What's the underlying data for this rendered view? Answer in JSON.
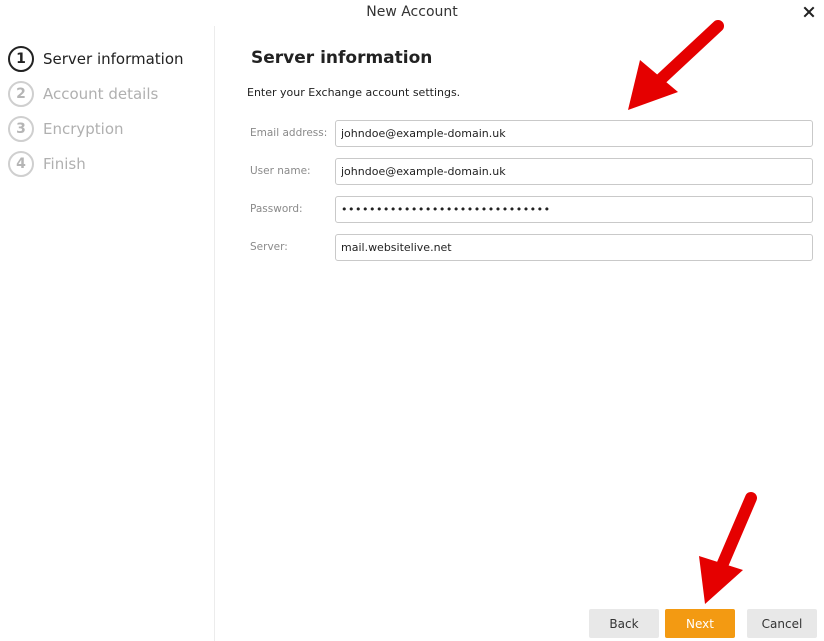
{
  "window": {
    "title": "New Account",
    "close_icon": "close-icon"
  },
  "steps": [
    {
      "number": "1",
      "label": "Server information",
      "active": true
    },
    {
      "number": "2",
      "label": "Account details",
      "active": false
    },
    {
      "number": "3",
      "label": "Encryption",
      "active": false
    },
    {
      "number": "4",
      "label": "Finish",
      "active": false
    }
  ],
  "main": {
    "heading": "Server information",
    "subtitle": "Enter your Exchange account settings.",
    "fields": {
      "email": {
        "label": "Email address:",
        "value": "johndoe@example-domain.uk"
      },
      "username": {
        "label": "User name:",
        "value": "johndoe@example-domain.uk"
      },
      "password": {
        "label": "Password:",
        "value": "••••••••••••••••••••••••••••••"
      },
      "server": {
        "label": "Server:",
        "value": "mail.websitelive.net"
      }
    }
  },
  "buttons": {
    "back": "Back",
    "next": "Next",
    "cancel": "Cancel"
  },
  "colors": {
    "accent": "#f39a12",
    "annotation_arrow": "#e50000",
    "active_step": "#222222",
    "inactive_step": "#b0b0b0"
  }
}
